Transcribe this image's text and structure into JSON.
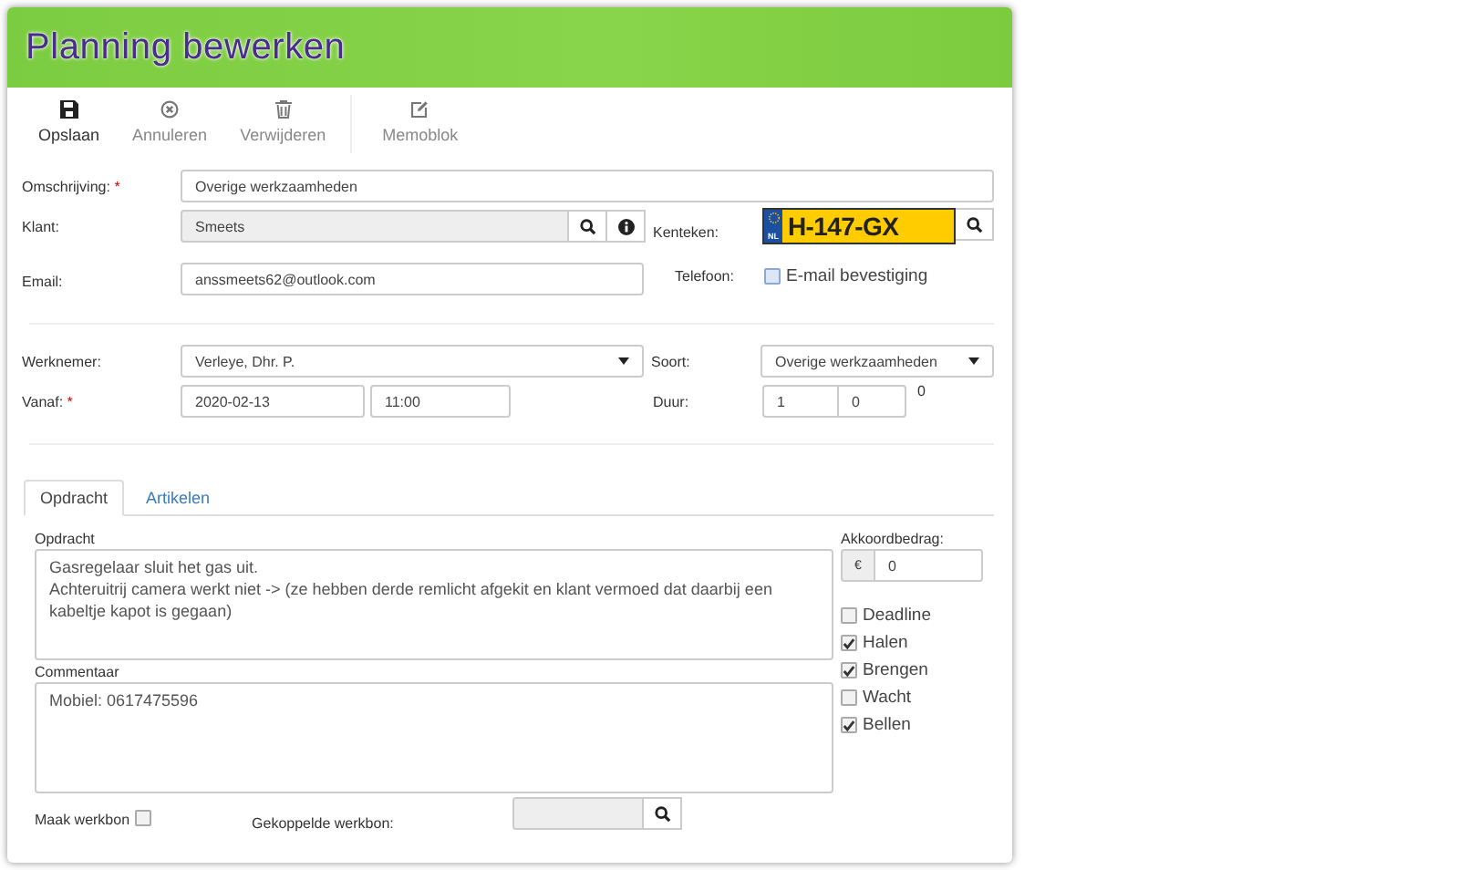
{
  "header": {
    "title": "Planning bewerken"
  },
  "toolbar": [
    {
      "label": "Opslaan",
      "kind": "save",
      "disabled": false,
      "separator_before": false
    },
    {
      "label": "Annuleren",
      "kind": "cancel",
      "disabled": true,
      "separator_before": false
    },
    {
      "label": "Verwijderen",
      "kind": "trash",
      "disabled": true,
      "separator_before": false
    },
    {
      "label": "Memoblok",
      "kind": "edit",
      "disabled": true,
      "separator_before": true
    }
  ],
  "description": {
    "label": "Omschrijving:",
    "required_mark": "*",
    "value": "Overige werkzaamheden"
  },
  "customer": {
    "label": "Klant:",
    "value": "Smeets"
  },
  "plate": {
    "label": "Kenteken:",
    "country": "NL",
    "value": "H-147-GX"
  },
  "email": {
    "label": "Email:",
    "value": "anssmeets62@outlook.com"
  },
  "phone": {
    "label": "Telefoon:"
  },
  "email_confirmation": {
    "label": "E-mail bevestiging",
    "checked": false
  },
  "employee": {
    "label": "Werknemer:",
    "value": "Verleye, Dhr. P."
  },
  "type": {
    "label": "Soort:",
    "value": "Overige werkzaamheden"
  },
  "from": {
    "label": "Vanaf:",
    "required_mark": "*",
    "date": "2020-02-13",
    "time": "11:00"
  },
  "duration": {
    "label": "Duur:",
    "hours": "1",
    "minutes": "0",
    "total": "0"
  },
  "tabs": [
    {
      "label": "Opdracht",
      "selected": true
    },
    {
      "label": "Artikelen",
      "selected": false
    }
  ],
  "assignment": {
    "label": "Opdracht",
    "value": "Gasregelaar sluit het gas uit.\nAchteruitrij camera werkt niet -> (ze hebben derde remlicht afgekit en klant vermoed dat daarbij een kabeltje kapot is gegaan)"
  },
  "comment": {
    "label": "Commentaar",
    "value": "Mobiel: 0617475596"
  },
  "agreed_amount": {
    "label": "Akkoordbedrag:",
    "currency": "€",
    "value": "0"
  },
  "flags": [
    {
      "label": "Deadline",
      "checked": false
    },
    {
      "label": "Halen",
      "checked": true
    },
    {
      "label": "Brengen",
      "checked": true
    },
    {
      "label": "Wacht",
      "checked": false
    },
    {
      "label": "Bellen",
      "checked": true
    }
  ],
  "create_workorder": {
    "label": "Maak werkbon",
    "checked": false
  },
  "linked_workorder": {
    "label": "Gekoppelde werkbon:"
  }
}
